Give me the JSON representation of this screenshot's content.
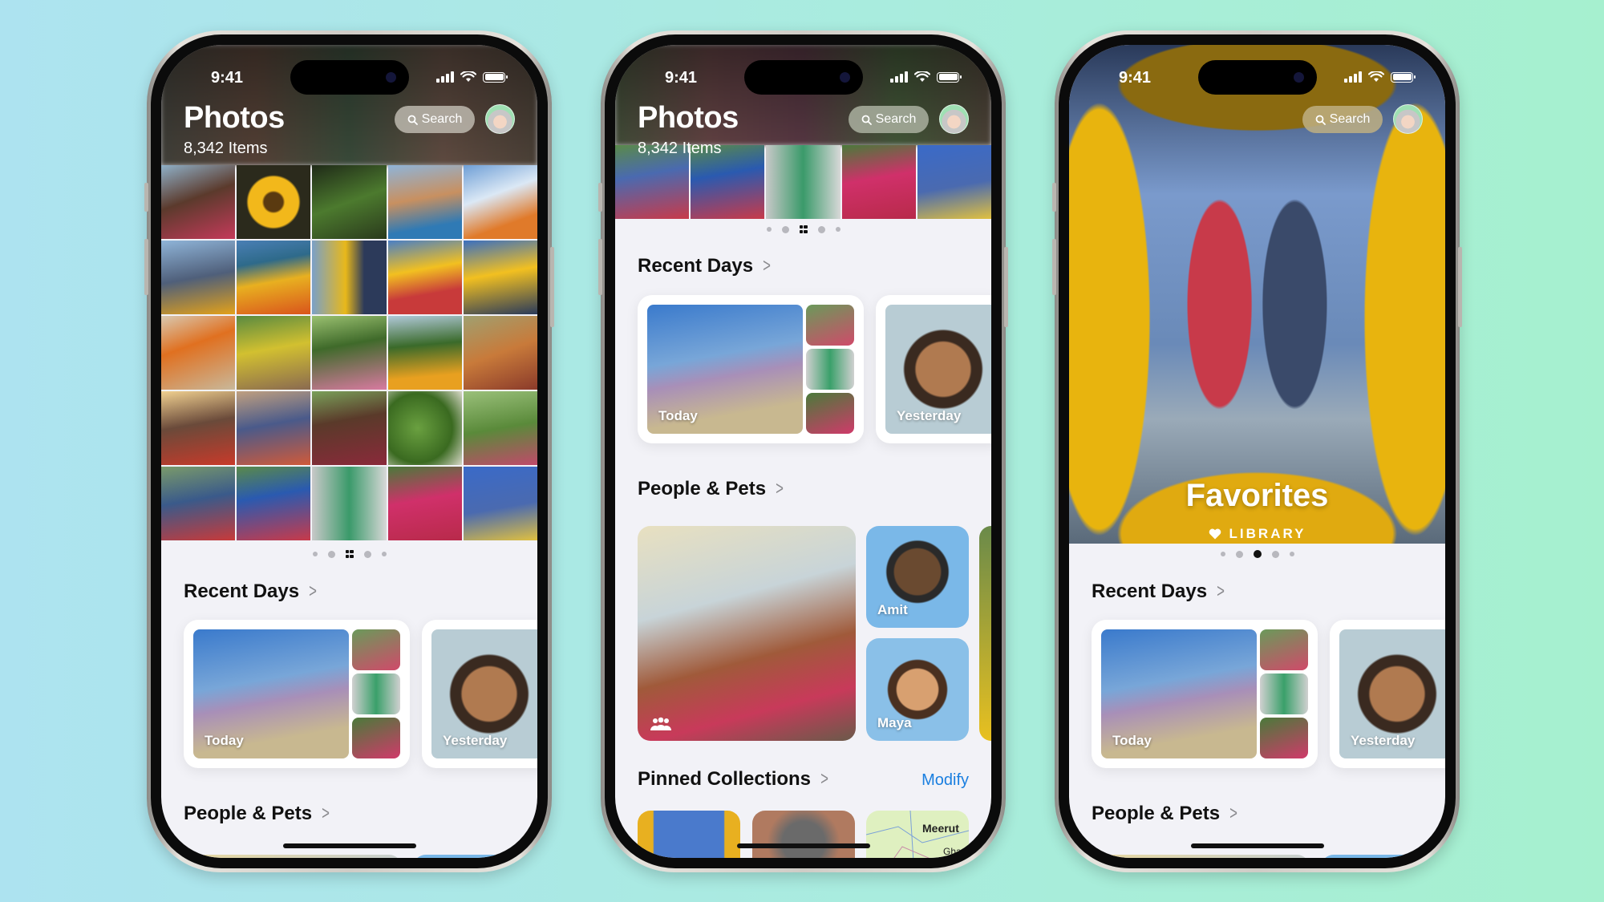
{
  "status_bar": {
    "time": "9:41"
  },
  "library": {
    "title": "Photos",
    "item_count": "8,342 Items",
    "search_label": "Search",
    "avatar": "memoji-avatar"
  },
  "sections": {
    "recent_days": "Recent Days",
    "people_pets": "People & Pets",
    "pinned_collections": "Pinned Collections",
    "modify": "Modify"
  },
  "recent_days_cards": [
    {
      "label": "Today"
    },
    {
      "label": "Yesterday"
    }
  ],
  "people": [
    {
      "name": "Amit"
    },
    {
      "name": "Maya"
    }
  ],
  "pinned": [
    {
      "type": "photo"
    },
    {
      "type": "photo"
    },
    {
      "type": "map",
      "labels": [
        "Meerut",
        "Ghaz"
      ]
    }
  ],
  "featured": {
    "title": "Favorites",
    "subtitle": "LIBRARY",
    "icon": "heart-icon"
  },
  "page_indicator": {
    "phone1_active": 3,
    "phone2_active": 3,
    "phone3_active": 3,
    "count": 5
  },
  "colors": {
    "accent_blue": "#1a7fe0",
    "background_left": "#ade3f0",
    "background_right": "#a6f0cf"
  }
}
